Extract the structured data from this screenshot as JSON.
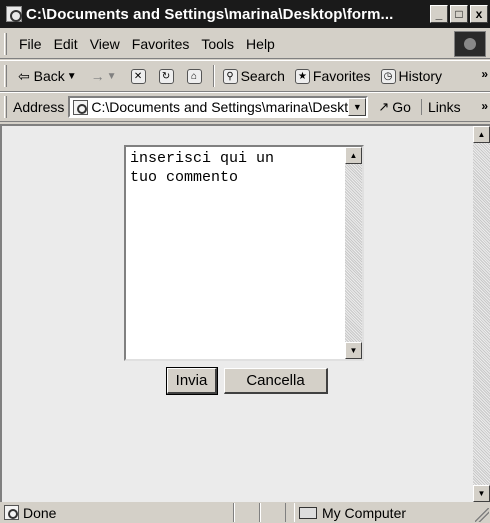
{
  "window": {
    "title": "C:\\Documents and Settings\\marina\\Desktop\\form...",
    "minimize": "_",
    "maximize": "□",
    "close": "x"
  },
  "menu": [
    "File",
    "Edit",
    "View",
    "Favorites",
    "Tools",
    "Help"
  ],
  "toolbar": {
    "back": "Back",
    "forward": "→",
    "search": "Search",
    "favorites": "Favorites",
    "history": "History",
    "more": "»"
  },
  "address": {
    "label": "Address",
    "value": "C:\\Documents and Settings\\marina\\Desktop\\form",
    "go": "Go",
    "links": "Links",
    "more": "»"
  },
  "form": {
    "textarea_value": "inserisci qui un\ntuo commento",
    "submit_label": "Invia",
    "reset_label": "Cancella"
  },
  "status": {
    "text": "Done",
    "zone": "My Computer"
  }
}
